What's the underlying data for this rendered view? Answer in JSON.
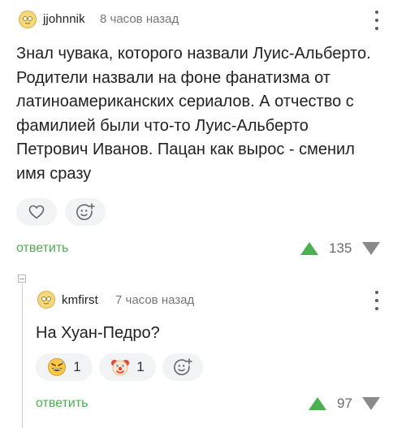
{
  "comment": {
    "username": "jjohnnik",
    "time": "8 часов назад",
    "text_lines": [
      "Знал чувака, которого назвали Луис-Альберто.",
      "Родители назвали на фоне фанатизма от",
      "латиноамериканских сериалов. А отчество с",
      "фамилией были что-то Луис-Альберто",
      "Петрович Иванов. Пацан как вырос - сменил",
      "имя сразу"
    ],
    "reply_label": "ответить",
    "rating": "135"
  },
  "reply": {
    "username": "kmfirst",
    "time": "7 часов назад",
    "text": "На Хуан-Педро?",
    "reactions": [
      {
        "icon": "grinning-sweat-emoji-icon",
        "count": "1"
      },
      {
        "icon": "clown-emoji-icon",
        "count": "1"
      }
    ],
    "reply_label": "ответить",
    "rating": "97"
  },
  "colors": {
    "accent_green": "#4caf50",
    "pill_bg": "#f2f3f5",
    "vote_down": "#8a8a8a"
  }
}
